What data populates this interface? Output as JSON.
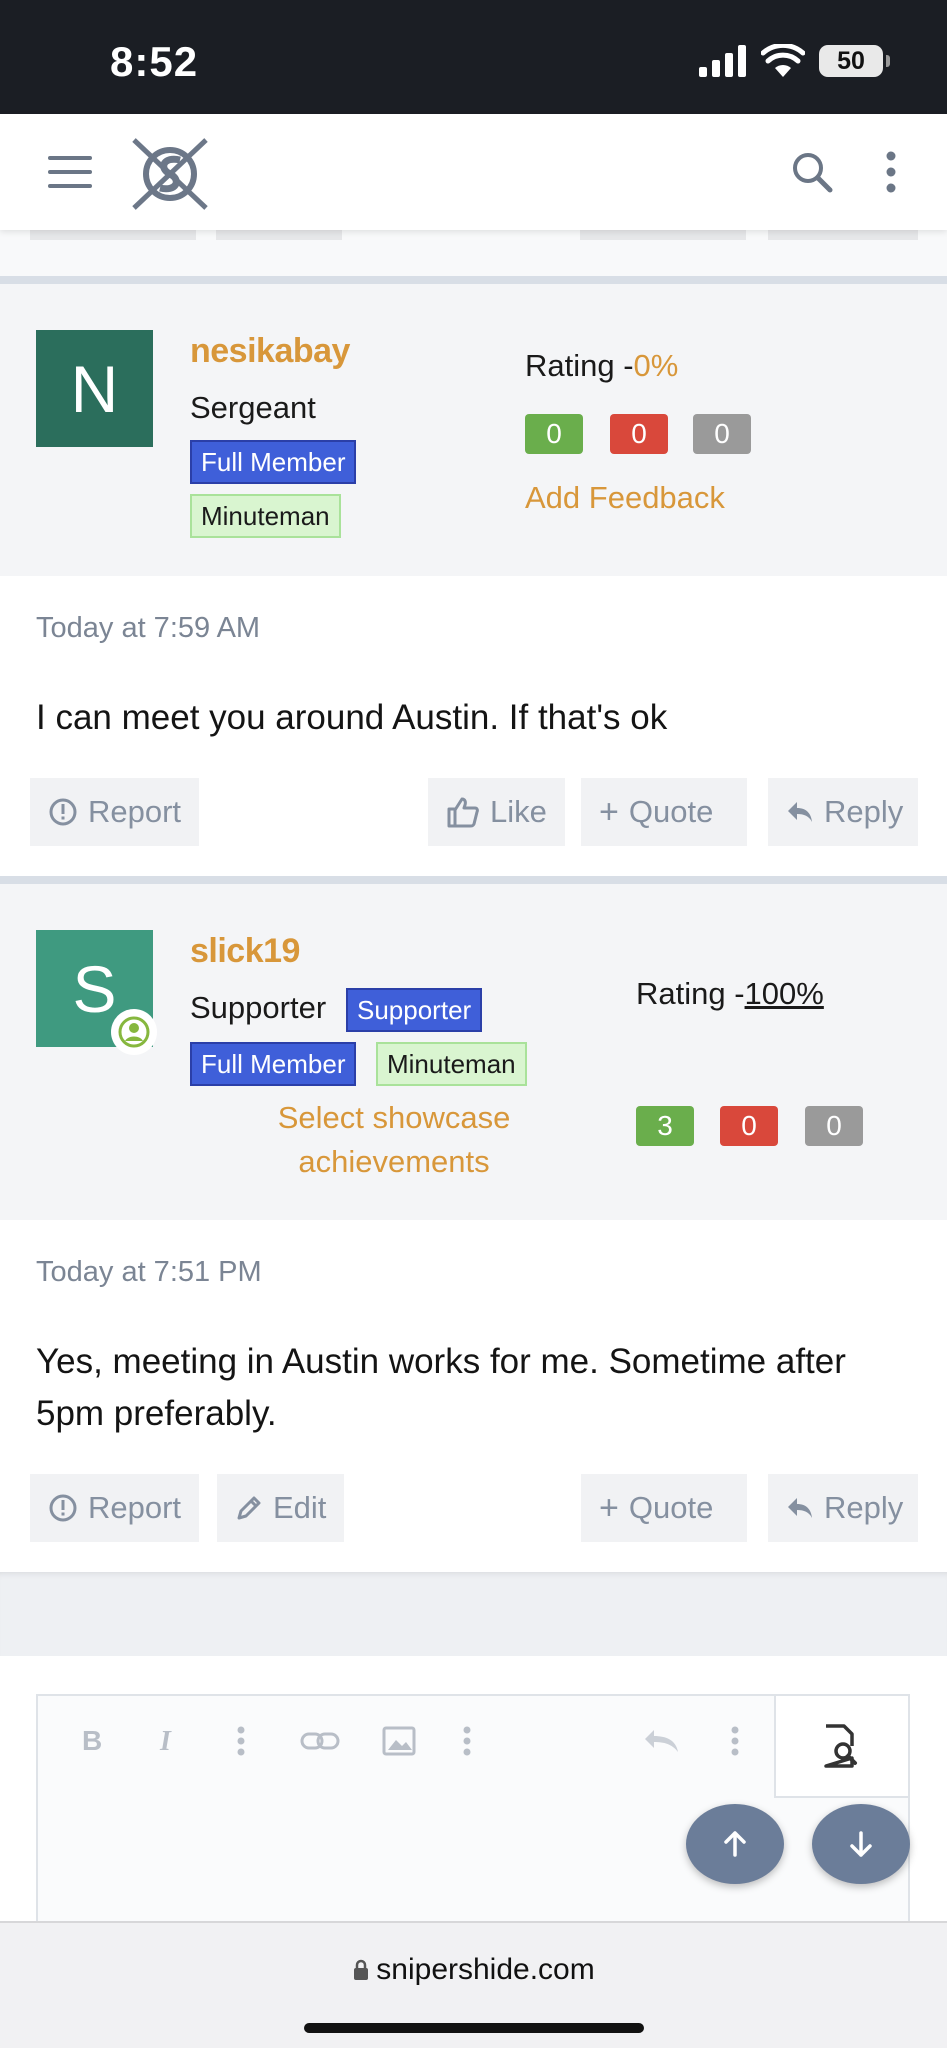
{
  "status_bar": {
    "time": "8:52",
    "battery": "50"
  },
  "header": {
    "menu": "menu",
    "logo": "site-logo",
    "search": "search",
    "more": "more"
  },
  "posts": [
    {
      "username": "nesikabay",
      "avatar_letter": "N",
      "avatar_color": "#2b6e5c",
      "title": "Sergeant",
      "badges": [
        "Full Member",
        "Minuteman"
      ],
      "rating_label": "Rating -",
      "rating_pct": "0%",
      "feedback": [
        "0",
        "0",
        "0"
      ],
      "add_feedback": "Add Feedback",
      "date": "Today at 7:59 AM",
      "text": "I can meet you around Austin. If that's ok",
      "actions": {
        "report": "Report",
        "like": "Like",
        "quote": "Quote",
        "reply": "Reply"
      }
    },
    {
      "username": "slick19",
      "avatar_letter": "S",
      "avatar_color": "#3f9a80",
      "title": "Supporter",
      "badges": [
        "Supporter",
        "Full Member",
        "Minuteman"
      ],
      "showcase": "Select showcase achievements",
      "rating_label": "Rating -",
      "rating_pct": "100%",
      "feedback": [
        "3",
        "0",
        "0"
      ],
      "date": "Today at 7:51 PM",
      "text": "Yes, meeting in Austin works for me. Sometime after 5pm preferably.",
      "actions": {
        "report": "Report",
        "edit": "Edit",
        "quote": "Quote",
        "reply": "Reply"
      }
    }
  ],
  "browser": {
    "url": "snipershide.com"
  },
  "colors": {
    "accent": "#d8973a",
    "badge_blue": "#3f5fd9",
    "badge_green": "#d9f5d0"
  }
}
